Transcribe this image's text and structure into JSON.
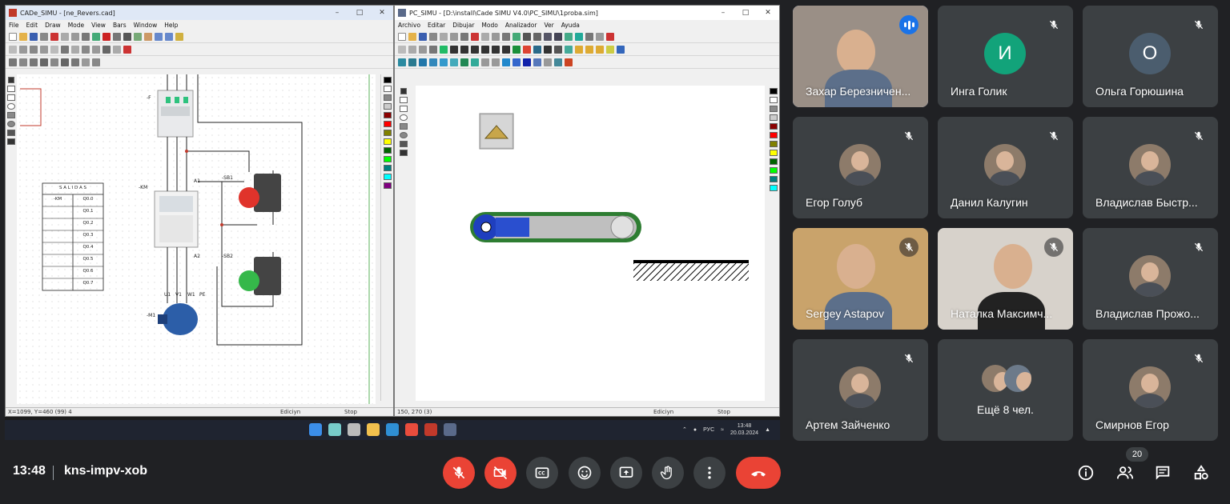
{
  "shared_screen": {
    "cade_window": {
      "title": "CADe_SIMU - [ne_Revers.cad]",
      "menu": [
        "File",
        "Edit",
        "Draw",
        "Mode",
        "View",
        "Bars",
        "Window",
        "Help"
      ],
      "labels": {
        "breaker": "-F",
        "contactor": "-KM",
        "sb1": "-SB1",
        "sb2": "-SB2",
        "motor": "-M1",
        "u1": "U1",
        "v1": "V1",
        "w1": "W1",
        "pe": "PE",
        "a1": "A1",
        "a2": "A2"
      },
      "salidas_table": {
        "title": "S A L I D A S",
        "rows": [
          [
            "-KM",
            "Q0.0"
          ],
          [
            "",
            "Q0.1"
          ],
          [
            "",
            "Q0.2"
          ],
          [
            "",
            "Q0.3"
          ],
          [
            "",
            "Q0.4"
          ],
          [
            "",
            "Q0.5"
          ],
          [
            "",
            "Q0.6"
          ],
          [
            "",
            "Q0.7"
          ]
        ]
      },
      "status": {
        "coords": "X=1099, Y=460 (99) 4",
        "mode": "Ediciyn",
        "state": "Stop"
      }
    },
    "pcsimu_window": {
      "title": "PC_SIMU - [D:\\install\\Cade SIMU V4.0\\PC_SIMU\\1proba.sim]",
      "menu": [
        "Archivo",
        "Editar",
        "Dibujar",
        "Modo",
        "Analizador",
        "Ver",
        "Ayuda"
      ],
      "status": {
        "coords": "150, 270 (3)",
        "mode": "Ediciyn",
        "state": "Stop"
      }
    },
    "taskbar": {
      "lang": "РУС",
      "time": "13:48",
      "date": "20.03.2024"
    }
  },
  "participants": [
    {
      "name": "Захар Березничен...",
      "type": "video",
      "speaking": true
    },
    {
      "name": "Инга Голик",
      "type": "initial",
      "initial": "И",
      "color": "#12a37a"
    },
    {
      "name": "Ольга Горюшина",
      "type": "initial",
      "initial": "О",
      "color": "#4b5d6e"
    },
    {
      "name": "Егор Голуб",
      "type": "photo"
    },
    {
      "name": "Данил Калугин",
      "type": "photo"
    },
    {
      "name": "Владислав Быстр...",
      "type": "photo"
    },
    {
      "name": "Sergey Astapov",
      "type": "video"
    },
    {
      "name": "Наталка Максимч...",
      "type": "video"
    },
    {
      "name": "Владислав Прожо...",
      "type": "photo"
    },
    {
      "name": "Артем Зайченко",
      "type": "photo"
    },
    {
      "name": "Ещё 8 чел.",
      "type": "more"
    },
    {
      "name": "Смирнов Егор",
      "type": "photo"
    }
  ],
  "meeting": {
    "time": "13:48",
    "code": "kns-impv-xob",
    "participant_count": "20"
  },
  "controls": [
    "mic-off-icon",
    "camera-off-icon",
    "captions-icon",
    "emoji-icon",
    "present-icon",
    "raise-hand-icon",
    "more-options-icon",
    "end-call-icon"
  ],
  "colors": {
    "accent": "#8ab4f8",
    "end_call": "#ea4335",
    "tile": "#3c4043"
  }
}
